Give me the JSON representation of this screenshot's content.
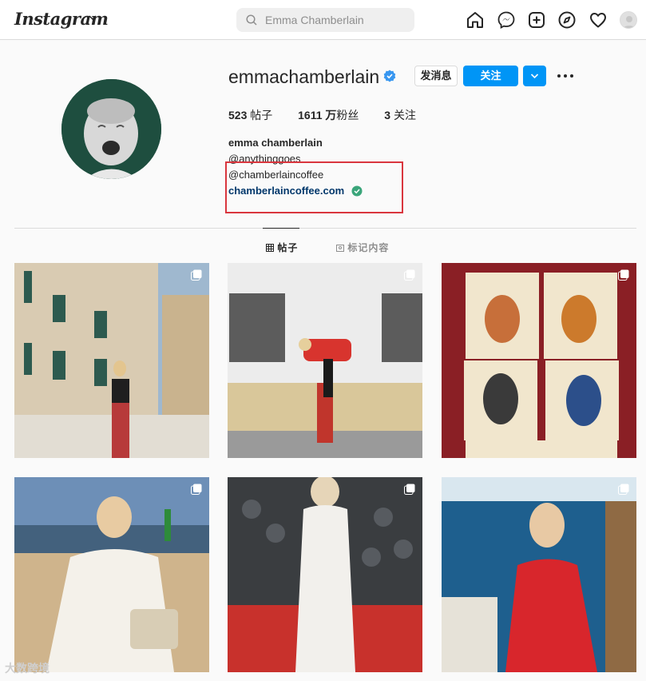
{
  "header": {
    "logo": "Instagram",
    "search_placeholder": "Emma Chamberlain"
  },
  "profile": {
    "username": "emmachamberlain",
    "message_button": "发消息",
    "follow_button": "关注",
    "stats": {
      "posts_count": "523",
      "posts_label": "帖子",
      "followers_count": "1611 万",
      "followers_label": "粉丝",
      "following_count": "3",
      "following_label": "关注"
    },
    "bio": {
      "name": "emma chamberlain",
      "line1": "@anythinggoes",
      "line2": "@chamberlaincoffee",
      "link": "chamberlaincoffee.com"
    }
  },
  "tabs": {
    "posts": "帖子",
    "tagged": "标记内容"
  },
  "watermark": "大数跨境",
  "colors": {
    "accent": "#0095f6",
    "highlight_box": "#d9363e",
    "link": "#00376b",
    "verified": "#3897f0",
    "link_verified": "#3aa57a"
  },
  "icons": [
    "home-icon",
    "messenger-icon",
    "new-post-icon",
    "explore-icon",
    "heart-icon",
    "profile-avatar",
    "grid-icon",
    "tag-icon",
    "multi-post-icon"
  ]
}
